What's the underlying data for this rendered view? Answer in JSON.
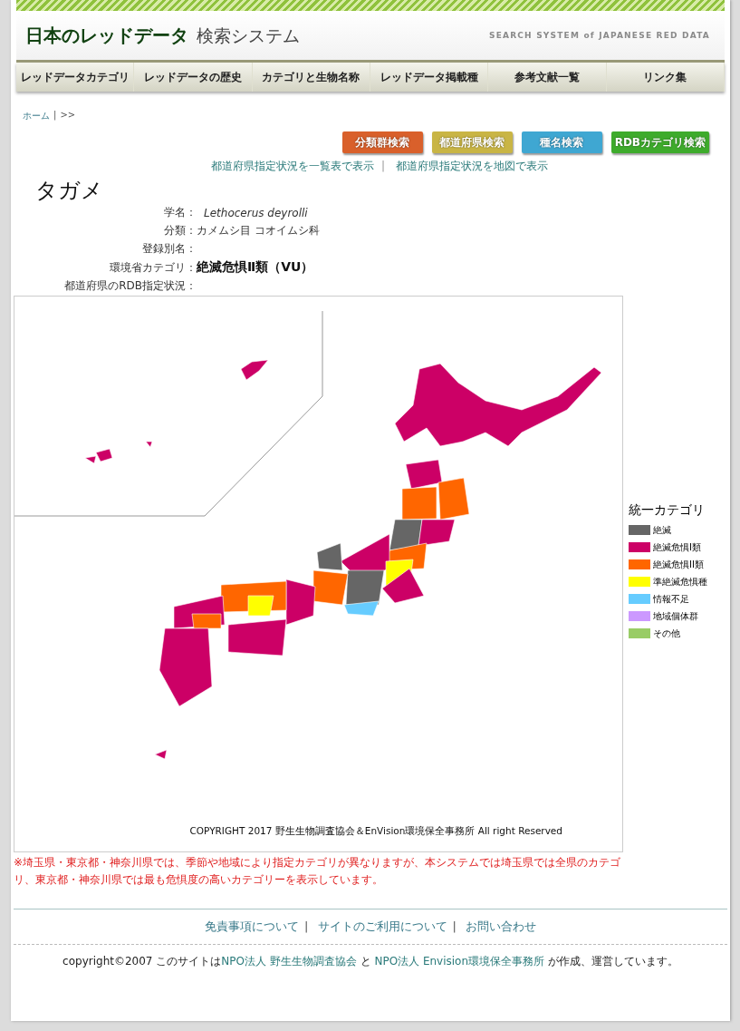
{
  "header": {
    "title": "日本のレッドデータ",
    "subtitle": "検索システム",
    "tagline": "SEARCH SYSTEM of JAPANESE RED DATA"
  },
  "nav": [
    "レッドデータカテゴリ",
    "レッドデータの歴史",
    "カテゴリと生物名称",
    "レッドデータ掲載種",
    "参考文献一覧",
    "リンク集"
  ],
  "breadcrumb": {
    "home": "ホーム",
    "separator": "|",
    "trail": ">>"
  },
  "search_buttons": [
    {
      "label": "分類群検索",
      "color": "#d9602b"
    },
    {
      "label": "都道府県検索",
      "color": "#c9b545"
    },
    {
      "label": "種名検索",
      "color": "#3fa7d2"
    },
    {
      "label": "RDBカテゴリ検索",
      "color": "#3eab2c"
    }
  ],
  "view_links": [
    "都道府県指定状況を一覧表で表示",
    "都道府県指定状況を地図で表示"
  ],
  "view_separator": "|",
  "species": {
    "name": "タガメ",
    "fields": [
      {
        "label": "学名：",
        "value": "Lethocerus deyrolli",
        "kind": "italic"
      },
      {
        "label": "分類：",
        "value": "カメムシ目 コオイムシ科",
        "kind": "plain"
      },
      {
        "label": "登録別名："
      },
      {
        "label": "環境省カテゴリ：",
        "value": "絶滅危惧Ⅱ類（VU）",
        "kind": "bold"
      },
      {
        "label": "都道府県のRDB指定状況："
      }
    ]
  },
  "map": {
    "copyright": "COPYRIGHT 2017 野生生物調査協会＆EnVision環境保全事務所 All right Reserved"
  },
  "legend": {
    "title": "統一カテゴリ",
    "items": [
      {
        "label": "絶滅",
        "color": "#666666"
      },
      {
        "label": "絶滅危惧Ⅰ類",
        "color": "#cc0066"
      },
      {
        "label": "絶滅危惧ⅠⅠ類",
        "color": "#ff6600"
      },
      {
        "label": "準絶滅危惧種",
        "color": "#ffff00"
      },
      {
        "label": "情報不足",
        "color": "#66ccff"
      },
      {
        "label": "地域個体群",
        "color": "#cc99ff"
      },
      {
        "label": "その他",
        "color": "#99cc66"
      }
    ]
  },
  "note": "※埼玉県・東京都・神奈川県では、季節や地域により指定カテゴリが異なりますが、本システムでは埼玉県では全県のカテゴリ、東京都・神奈川県では最も危惧度の高いカテゴリーを表示しています。",
  "footer_links": [
    "免責事項について",
    "サイトのご利用について",
    "お問い合わせ"
  ],
  "footer_separator": "|",
  "credit": [
    {
      "text": "copyright©2007 このサイトは",
      "kind": "plain"
    },
    {
      "text": "NPO法人 野生生物調査協会",
      "kind": "link"
    },
    {
      "text": " と ",
      "kind": "plain"
    },
    {
      "text": "NPO法人 Envision環境保全事務所",
      "kind": "link"
    },
    {
      "text": " が作成、運営しています。",
      "kind": "plain"
    }
  ]
}
